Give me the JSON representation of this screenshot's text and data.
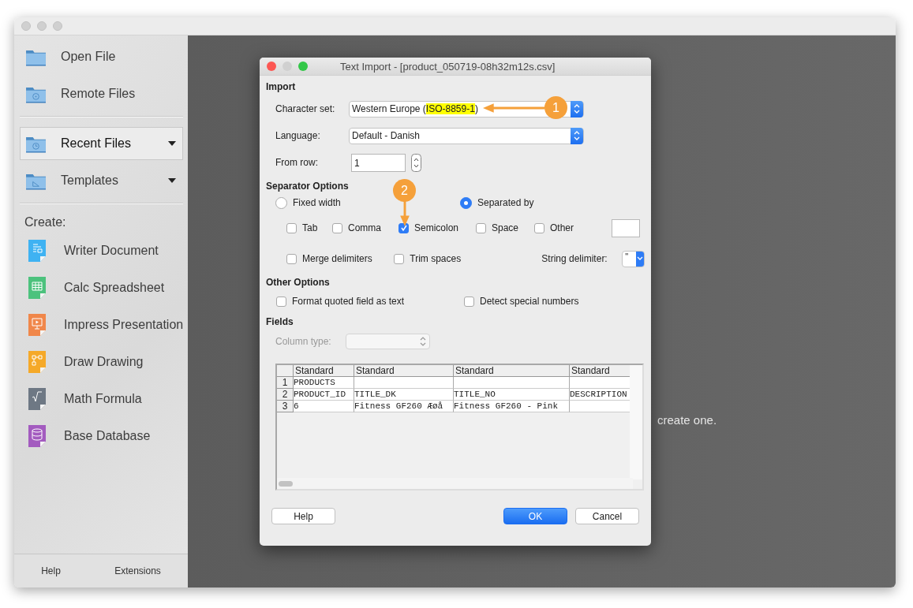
{
  "sidebar": {
    "items": [
      {
        "label": "Open File",
        "selected": false,
        "has_menu": false
      },
      {
        "label": "Remote Files",
        "selected": false,
        "has_menu": false
      },
      {
        "label": "Recent Files",
        "selected": true,
        "has_menu": true
      },
      {
        "label": "Templates",
        "selected": false,
        "has_menu": true
      }
    ],
    "create_heading": "Create:",
    "create_items": [
      {
        "label": "Writer Document",
        "color": "#3fb2f2"
      },
      {
        "label": "Calc Spreadsheet",
        "color": "#4cc27d"
      },
      {
        "label": "Impress Presentation",
        "color": "#f0874a"
      },
      {
        "label": "Draw Drawing",
        "color": "#f5a929"
      },
      {
        "label": "Math Formula",
        "color": "#6e7884"
      },
      {
        "label": "Base Database",
        "color": "#a35bbf"
      }
    ],
    "footer": [
      "Help",
      "Extensions"
    ]
  },
  "main": {
    "hint": "create one."
  },
  "dialog": {
    "title": "Text Import - [product_050719-08h32m12s.csv]",
    "import": {
      "heading": "Import",
      "charset_label": "Character set:",
      "charset_value": [
        {
          "text": "Western Europe (",
          "highlighted": false
        },
        {
          "text": "ISO-8859-1",
          "highlighted": true
        },
        {
          "text": ")",
          "highlighted": false
        }
      ],
      "language_label": "Language:",
      "language_value": "Default - Danish",
      "from_row_label": "From row:",
      "from_row_value": "1"
    },
    "separator": {
      "heading": "Separator Options",
      "modes": [
        {
          "label": "Fixed width",
          "selected": false
        },
        {
          "label": "Separated by",
          "selected": true
        }
      ],
      "delimiters": [
        {
          "label": "Tab",
          "checked": false
        },
        {
          "label": "Comma",
          "checked": false
        },
        {
          "label": "Semicolon",
          "checked": true
        },
        {
          "label": "Space",
          "checked": false
        },
        {
          "label": "Other",
          "checked": false
        }
      ],
      "merge": {
        "label": "Merge delimiters",
        "checked": false
      },
      "trim": {
        "label": "Trim spaces",
        "checked": false
      },
      "string_delimiter_label": "String delimiter:",
      "string_delimiter_value": "\""
    },
    "other": {
      "heading": "Other Options",
      "options": [
        {
          "label": "Format quoted field as text",
          "checked": false
        },
        {
          "label": "Detect special numbers",
          "checked": false
        }
      ]
    },
    "fields": {
      "heading": "Fields",
      "column_type_label": "Column type:",
      "column_type_disabled": true,
      "columns": [
        "Standard",
        "Standard",
        "Standard",
        "Standard"
      ],
      "rows": [
        {
          "number": "1",
          "cells": [
            "PRODUCTS",
            null,
            null,
            null
          ]
        },
        {
          "number": "2",
          "cells": [
            "PRODUCT_ID",
            "TITLE_DK",
            "TITLE_NO",
            "DESCRIPTION"
          ]
        },
        {
          "number": "3",
          "cells": [
            "6",
            "Fitness GF260 Æøå",
            "Fitness GF260 - Pink",
            null
          ]
        }
      ]
    },
    "buttons": [
      {
        "label": "Help",
        "default": false
      },
      {
        "label": "OK",
        "default": true
      },
      {
        "label": "Cancel",
        "default": false
      }
    ]
  },
  "annotations": [
    {
      "label": "1"
    },
    {
      "label": "2"
    }
  ]
}
